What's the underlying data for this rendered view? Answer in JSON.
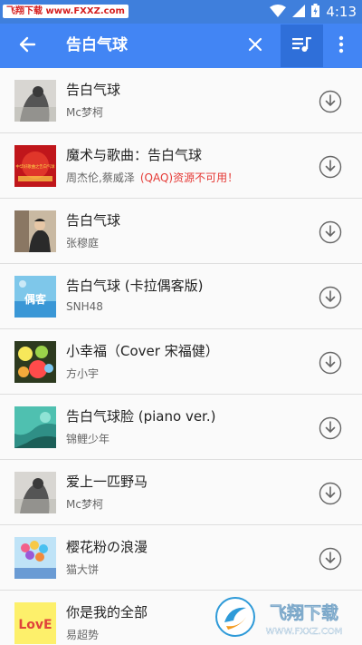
{
  "status_bar": {
    "watermark_text": "飞翔下载 www.FXXZ.com",
    "time": "4:13"
  },
  "toolbar": {
    "search_query": "告白气球",
    "back_icon": "arrow-left-icon",
    "clear_icon": "close-icon",
    "queue_icon": "playlist-icon",
    "more_icon": "more-vertical-icon"
  },
  "songs": [
    {
      "title": "告白气球",
      "artist": "Mc梦柯",
      "error": ""
    },
    {
      "title": "魔术与歌曲：告白气球",
      "artist": "周杰伦,蔡威泽",
      "error": "(QAQ)资源不可用！"
    },
    {
      "title": "告白气球",
      "artist": "张穆庭",
      "error": ""
    },
    {
      "title": "告白气球 (卡拉偶客版)",
      "artist": "SNH48",
      "error": ""
    },
    {
      "title": "小幸福（Cover 宋福健）",
      "artist": "方小宇",
      "error": ""
    },
    {
      "title": "告白气球脸 (piano ver.)",
      "artist": "锦鲤少年",
      "error": ""
    },
    {
      "title": "爱上一匹野马",
      "artist": "Mc梦柯",
      "error": ""
    },
    {
      "title": "樱花粉の浪漫",
      "artist": "猫大饼",
      "error": ""
    },
    {
      "title": "你是我的全部",
      "artist": "易超势",
      "error": ""
    }
  ],
  "thumb_texts": {
    "song2": "中华好歌曲之告白气球",
    "song4": "偶客",
    "song9": "LovE"
  },
  "corner_logo": {
    "brand": "飞翔下载",
    "url": "WWW.FXXZ.COM"
  },
  "colors": {
    "status_bar": "#3f7fdc",
    "toolbar": "#4285f4",
    "error_text": "#e53935"
  }
}
